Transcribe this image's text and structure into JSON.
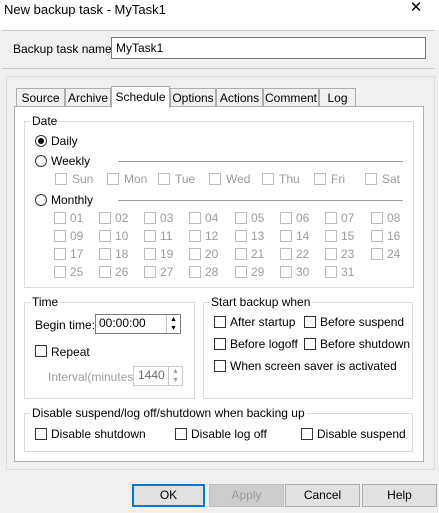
{
  "window": {
    "title": "New backup task - MyTask1",
    "close_glyph": "✕"
  },
  "task_name": {
    "label": "Backup task name:",
    "value": "MyTask1"
  },
  "tabs": [
    "Source",
    "Archive",
    "Schedule",
    "Options",
    "Actions",
    "Comment",
    "Log"
  ],
  "active_tab": "Schedule",
  "date": {
    "legend": "Date",
    "daily": "Daily",
    "weekly": "Weekly",
    "monthly": "Monthly",
    "selected": "Daily",
    "weekdays": [
      "Sun",
      "Mon",
      "Tue",
      "Wed",
      "Thu",
      "Fri",
      "Sat"
    ],
    "month_days": [
      "01",
      "02",
      "03",
      "04",
      "05",
      "06",
      "07",
      "08",
      "09",
      "10",
      "11",
      "12",
      "13",
      "14",
      "15",
      "16",
      "17",
      "18",
      "19",
      "20",
      "21",
      "22",
      "23",
      "24",
      "25",
      "26",
      "27",
      "28",
      "29",
      "30",
      "31"
    ]
  },
  "time": {
    "legend": "Time",
    "begin_label": "Begin time:",
    "begin_value": "00:00:00",
    "repeat_label": "Repeat",
    "interval_label": "Interval(minutes):",
    "interval_value": "1440"
  },
  "start_backup": {
    "legend": "Start backup when",
    "after_startup": "After startup",
    "before_suspend": "Before suspend",
    "before_logoff": "Before logoff",
    "before_shutdown": "Before shutdown",
    "screen_saver": "When screen saver is activated"
  },
  "disable": {
    "legend": "Disable suspend/log off/shutdown when backing up",
    "shutdown": "Disable shutdown",
    "logoff": "Disable log off",
    "suspend": "Disable suspend"
  },
  "buttons": {
    "ok": "OK",
    "apply": "Apply",
    "cancel": "Cancel",
    "help": "Help"
  }
}
